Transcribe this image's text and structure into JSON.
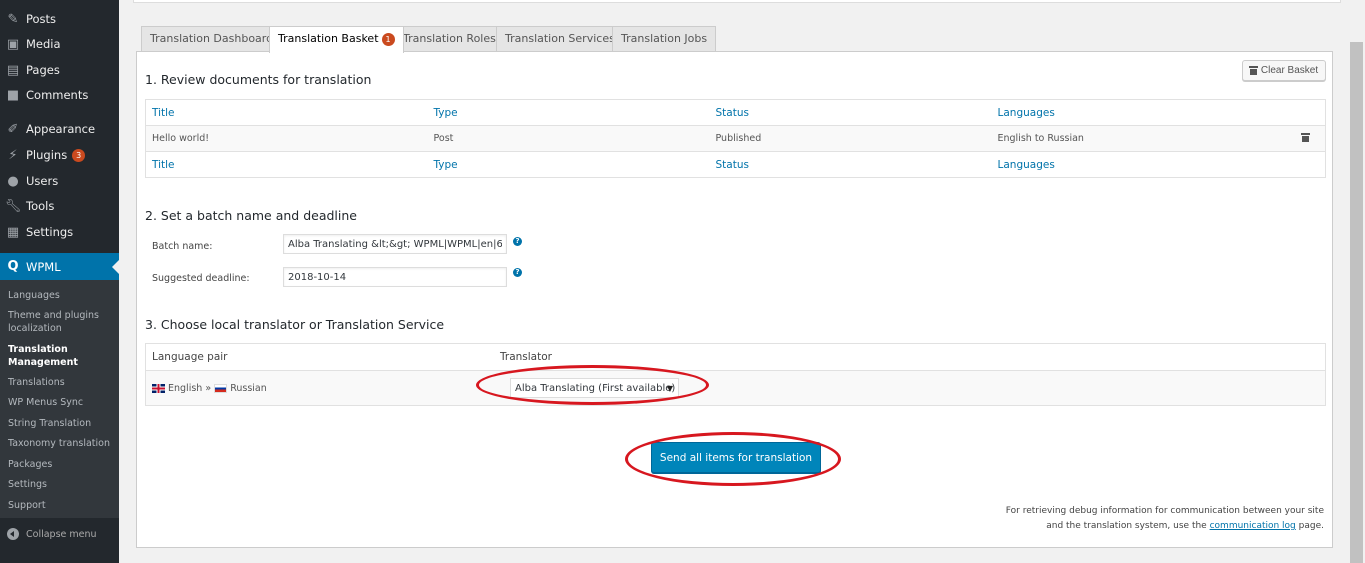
{
  "sidebar": {
    "items": [
      {
        "label": "Posts",
        "icon": "pin-icon"
      },
      {
        "label": "Media",
        "icon": "media-icon"
      },
      {
        "label": "Pages",
        "icon": "pages-icon"
      },
      {
        "label": "Comments",
        "icon": "comment-icon"
      },
      {
        "label": "Appearance",
        "icon": "brush-icon"
      },
      {
        "label": "Plugins",
        "icon": "plugin-icon",
        "badge": "3"
      },
      {
        "label": "Users",
        "icon": "user-icon"
      },
      {
        "label": "Tools",
        "icon": "wrench-icon"
      },
      {
        "label": "Settings",
        "icon": "settings-icon"
      }
    ],
    "active": {
      "label": "WPML",
      "icon": "wpml-icon"
    },
    "submenu": [
      {
        "label": "Languages"
      },
      {
        "label": "Theme and plugins localization"
      },
      {
        "label": "Translation Management",
        "current": true
      },
      {
        "label": "Translations"
      },
      {
        "label": "WP Menus Sync"
      },
      {
        "label": "String Translation"
      },
      {
        "label": "Taxonomy translation"
      },
      {
        "label": "Packages"
      },
      {
        "label": "Settings"
      },
      {
        "label": "Support"
      }
    ],
    "collapse_label": "Collapse menu"
  },
  "tabs": [
    {
      "label": "Translation Dashboard",
      "active": false
    },
    {
      "label": "Translation Basket",
      "active": true,
      "badge": "1"
    },
    {
      "label": "Translation Roles",
      "active": false
    },
    {
      "label": "Translation Services",
      "active": false
    },
    {
      "label": "Translation Jobs",
      "active": false
    }
  ],
  "section1": {
    "title": "1. Review documents for translation",
    "clear_basket_label": "Clear Basket",
    "columns": [
      "Title",
      "Type",
      "Status",
      "Languages"
    ],
    "rows": [
      {
        "title": "Hello world!",
        "type": "Post",
        "status": "Published",
        "languages": "English to Russian"
      }
    ]
  },
  "section2": {
    "title": "2. Set a batch name and deadline",
    "batch_name_label": "Batch name:",
    "batch_name_value": "Alba Translating &lt;&gt; WPML|WPML|en|6",
    "deadline_label": "Suggested deadline:",
    "deadline_value": "2018-10-14",
    "help_glyph": "?"
  },
  "section3": {
    "title": "3. Choose local translator or Translation Service",
    "col_language_pair": "Language pair",
    "col_translator": "Translator",
    "source_language": "English",
    "separator": "»",
    "target_language": "Russian",
    "translator_selected": "Alba Translating (First available)",
    "caret": "▼"
  },
  "send_button_label": "Send all items for translation",
  "debug_note": {
    "text_before": "For retrieving debug information for communication between your site and the translation system, use the",
    "link_text": "communication log",
    "text_after": "page."
  },
  "annotation_color": "#d7171f",
  "accent_color": "#0073aa"
}
